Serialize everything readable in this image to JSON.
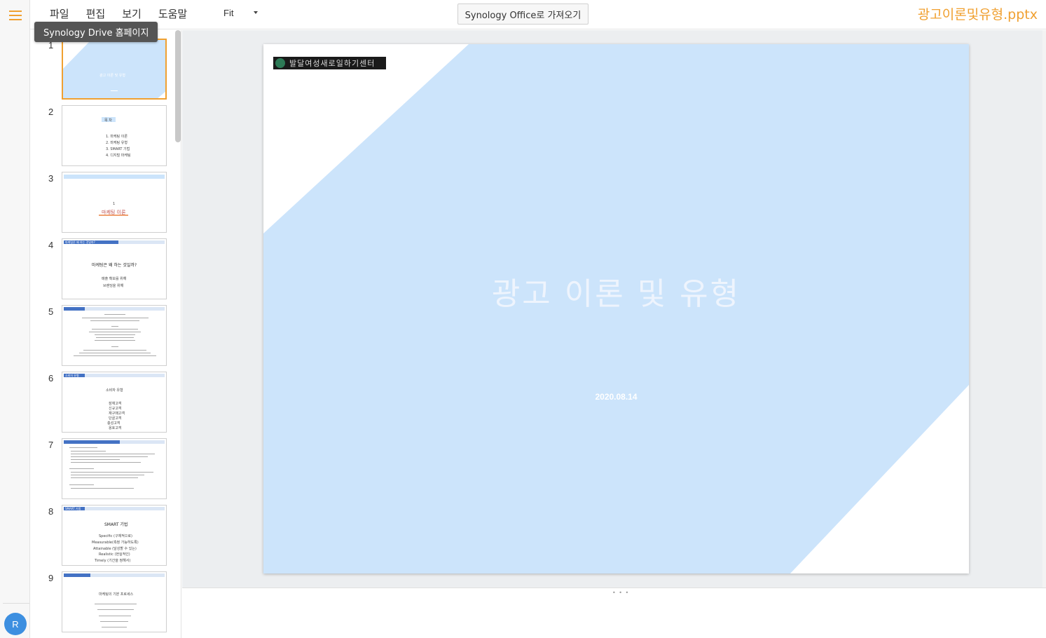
{
  "menu": [
    "파일",
    "편집",
    "보기",
    "도움말"
  ],
  "zoom": "Fit",
  "import_button": "Synology Office로 가져오기",
  "doc_title": "광고이론및유형.pptx",
  "tooltip": "Synology Drive 홈페이지",
  "user_initial": "R",
  "colors": {
    "accent": "#f0a030",
    "slide_blue": "#cce4fb",
    "header_blue": "#4472c4"
  },
  "thumbnails": {
    "numbers": [
      "1",
      "2",
      "3",
      "4",
      "5",
      "6",
      "7",
      "8",
      "9"
    ],
    "t1": {
      "title": "광고 이론 및 유형"
    },
    "t2": {
      "heading": "목 차",
      "items": [
        "1. 마케팅 이론",
        "2. 마케팅 유형",
        "3. SMART 기법",
        "4. 디지털 마케팅"
      ]
    },
    "t3": {
      "num": "1",
      "title": "마케팅 이론"
    },
    "t4": {
      "header": "마케팅은 왜 하는 것일까?",
      "question": "마케팅은 왜 하는 것일까?",
      "lines": [
        "매출 확보를 위해",
        "브랜딩을 위해"
      ]
    },
    "t6": {
      "header": "소비자 유형",
      "title": "소비자 유형",
      "items": [
        "잠재고객",
        "신규고객",
        "재구매고객",
        "단골고객",
        "충성고객",
        "옹호고객"
      ]
    },
    "t8": {
      "header": "SMART 기법",
      "title": "SMART 기법",
      "items": [
        "Specific (구체적으로)",
        "Measurable(측정 가능하도록)",
        "Attainable (달성할 수 있는)",
        "Realistic (현실적인)",
        "Timely (기간을 정해서)"
      ]
    },
    "t9": {
      "header": "마케팅의 기본 프로세스",
      "title": "마케팅의 기본 프로세스"
    }
  },
  "slide": {
    "logo_text": "발달여성새로일하기센터",
    "title": "광고 이론 및 유형",
    "date": "2020.08.14"
  }
}
